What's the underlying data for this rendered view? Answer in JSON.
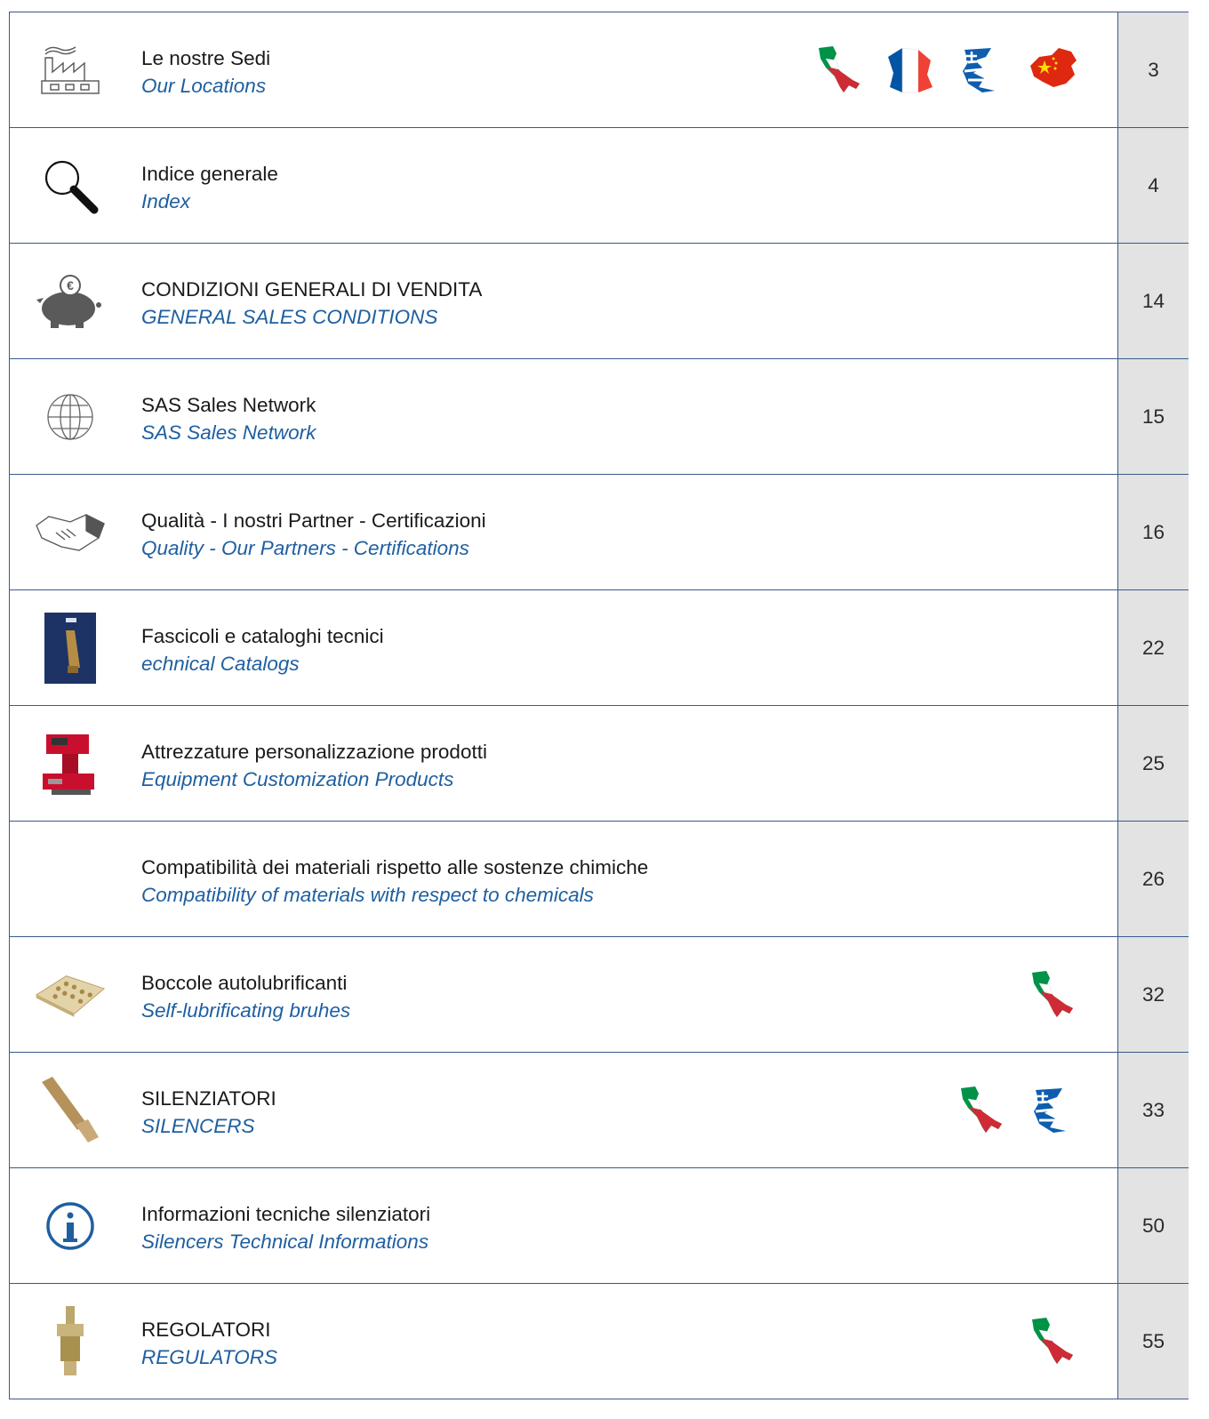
{
  "rows": [
    {
      "icon": "factory-icon",
      "title_it": "Le nostre Sedi",
      "title_en": "Our Locations",
      "flags": [
        "italy",
        "france",
        "greece",
        "china"
      ],
      "page": "3"
    },
    {
      "icon": "magnifier-icon",
      "title_it": "Indice generale",
      "title_en": "Index",
      "flags": [],
      "page": "4"
    },
    {
      "icon": "piggy-bank-icon",
      "title_it": "CONDIZIONI GENERALI DI VENDITA",
      "title_en": "GENERAL SALES CONDITIONS",
      "flags": [],
      "page": "14"
    },
    {
      "icon": "globe-icon",
      "title_it": "SAS Sales Network",
      "title_en": "SAS Sales Network",
      "flags": [],
      "page": "15"
    },
    {
      "icon": "handshake-icon",
      "title_it": "Qualità - I nostri Partner - Certificazioni",
      "title_en": "Quality - Our Partners - Certifications",
      "flags": [],
      "page": "16"
    },
    {
      "icon": "catalog-cover-icon",
      "title_it": "Fascicoli e cataloghi tecnici",
      "title_en": "echnical Catalogs",
      "flags": [],
      "page": "22"
    },
    {
      "icon": "marking-machine-icon",
      "title_it": "Attrezzature personalizzazione prodotti",
      "title_en": "Equipment Customization Products",
      "flags": [],
      "page": "25"
    },
    {
      "icon": "",
      "title_it": "Compatibilità dei materiali rispetto alle sostenze chimiche",
      "title_en": "Compatibility of materials with respect to chemicals",
      "flags": [],
      "page": "26"
    },
    {
      "icon": "bronze-plate-icon",
      "title_it": "Boccole autolubrificanti",
      "title_en": "Self-lubrificating bruhes",
      "flags": [
        "italy"
      ],
      "page": "32"
    },
    {
      "icon": "silencer-icon",
      "title_it": "SILENZIATORI",
      "title_en": "SILENCERS",
      "flags": [
        "italy",
        "greece"
      ],
      "page": "33"
    },
    {
      "icon": "info-icon",
      "title_it": "Informazioni tecniche silenziatori",
      "title_en": "Silencers Technical Informations",
      "flags": [],
      "page": "50"
    },
    {
      "icon": "regulator-icon",
      "title_it": "REGOLATORI",
      "title_en": "REGULATORS",
      "flags": [
        "italy"
      ],
      "page": "55"
    }
  ]
}
